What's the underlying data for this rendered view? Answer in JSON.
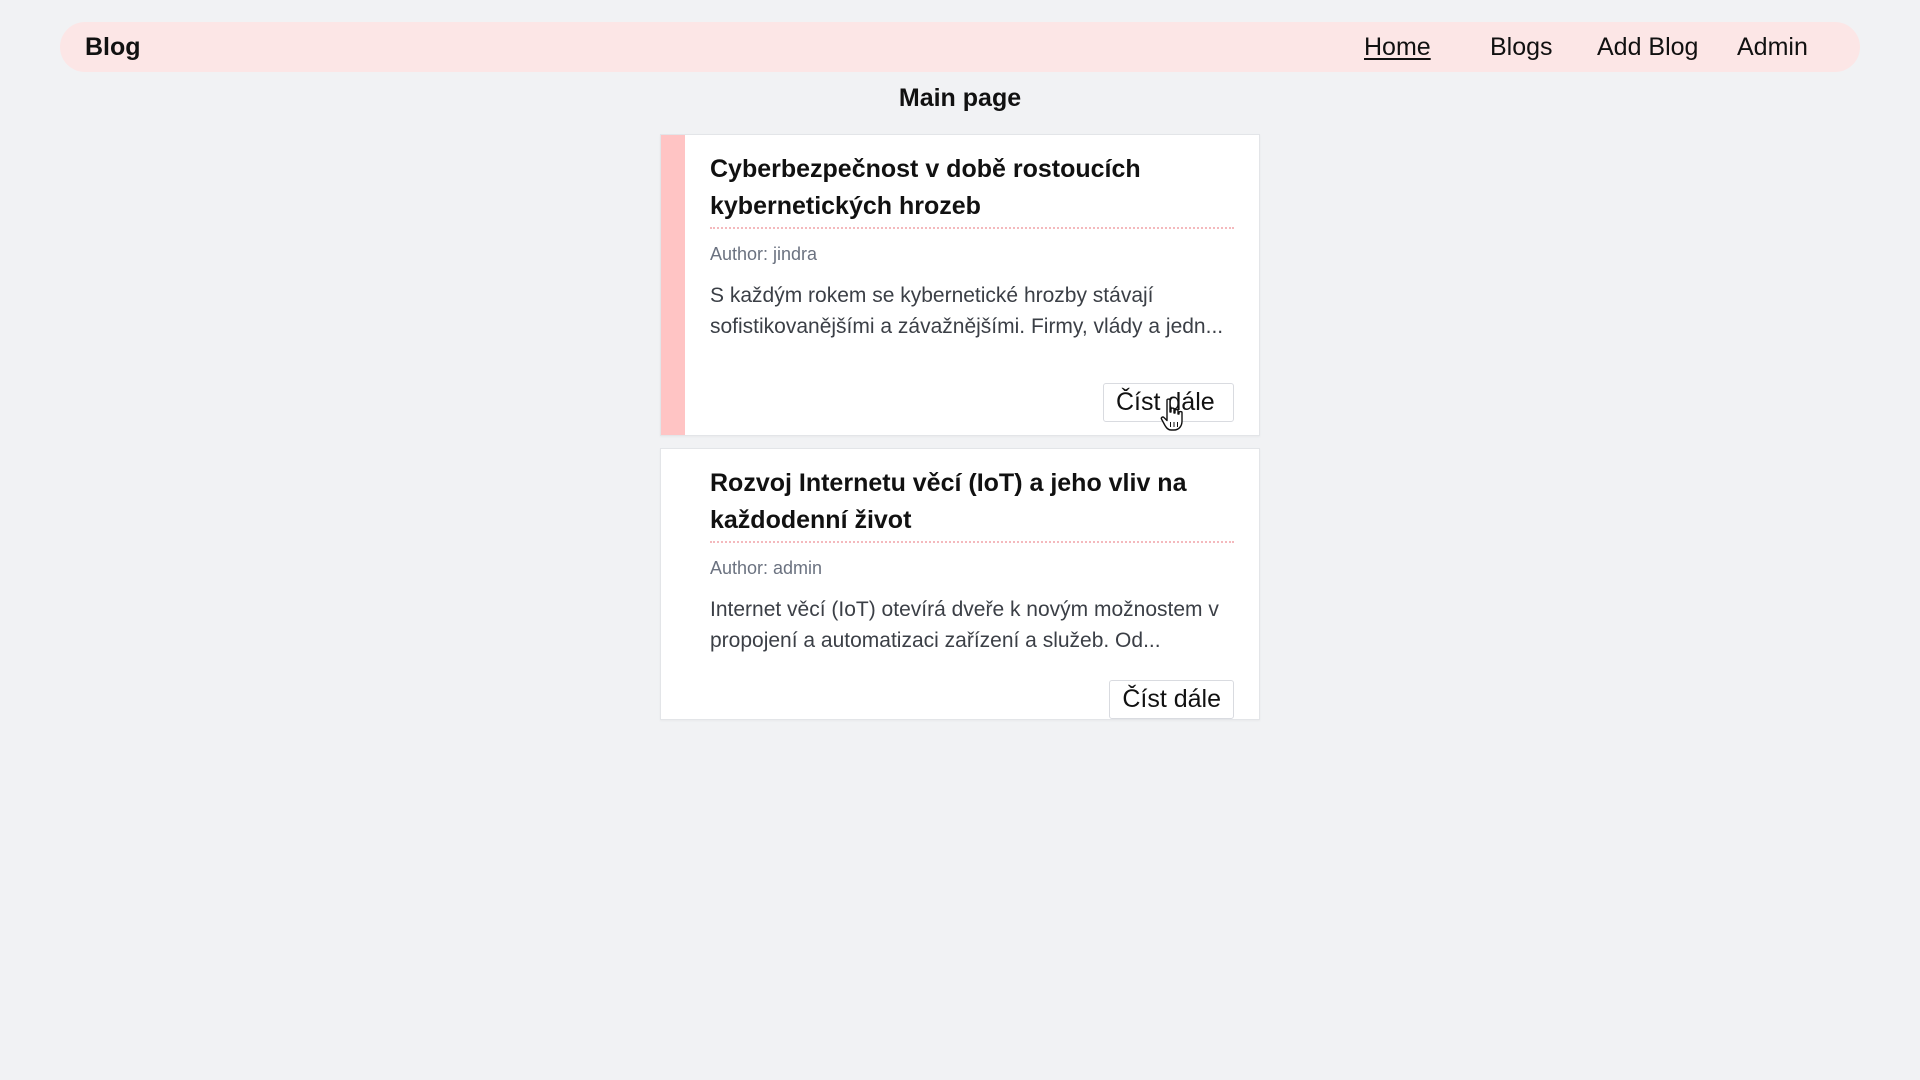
{
  "navbar": {
    "brand": "Blog",
    "links": [
      {
        "label": "Home",
        "active": true
      },
      {
        "label": "Blogs",
        "active": false
      },
      {
        "label": "Add Blog",
        "active": false
      },
      {
        "label": "Admin",
        "active": false
      }
    ]
  },
  "main": {
    "title": "Main page",
    "posts": [
      {
        "title": "Cyberbezpečnost v době rostoucích kybernetických hrozeb",
        "author": "Author: jindra",
        "excerpt": "S každým rokem se kybernetické hrozby stávají sofistikovanějšími a závažnějšími. Firmy, vlády a jedn...",
        "button_label": "Číst dále",
        "highlighted": true
      },
      {
        "title": "Rozvoj Internetu věcí (IoT) a jeho vliv na každodenní život",
        "author": "Author: admin",
        "excerpt": "Internet věcí (IoT) otevírá dveře k novým možnostem v propojení a automatizaci zařízení a služeb. Od...",
        "button_label": "Číst dále",
        "highlighted": false
      }
    ]
  },
  "colors": {
    "navbar_bg": "#fce6e6",
    "accent": "#ffc4c4",
    "page_bg": "#f1f2f4",
    "title_underline": "#f4b9bd"
  },
  "icons": {
    "cursor": "hand-pointer-icon"
  }
}
